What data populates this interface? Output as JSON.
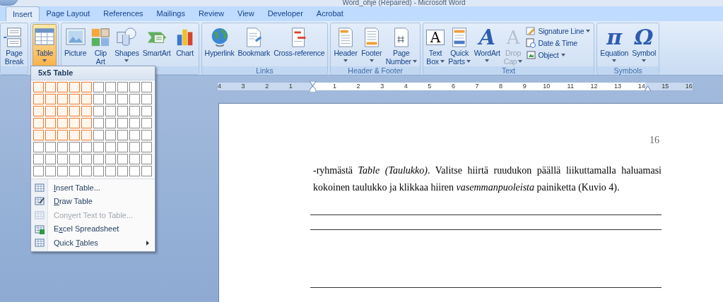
{
  "window": {
    "title": "Word_ohje (Repaired) - Microsoft Word"
  },
  "tabs": [
    {
      "label": "Insert",
      "selected": true
    },
    {
      "label": "Page Layout",
      "selected": false
    },
    {
      "label": "References",
      "selected": false
    },
    {
      "label": "Mailings",
      "selected": false
    },
    {
      "label": "Review",
      "selected": false
    },
    {
      "label": "View",
      "selected": false
    },
    {
      "label": "Developer",
      "selected": false
    },
    {
      "label": "Acrobat",
      "selected": false
    }
  ],
  "ribbon": {
    "groups": [
      {
        "buttons": [
          {
            "lines": [
              "Page",
              "Break"
            ],
            "dropdown": false,
            "selected": false,
            "disabled": false
          }
        ]
      },
      {
        "buttons": [
          {
            "lines": [
              "Table"
            ],
            "dropdown": true,
            "selected": true,
            "disabled": false
          }
        ]
      },
      {
        "buttons": [
          {
            "lines": [
              "Picture"
            ],
            "dropdown": false,
            "selected": false,
            "disabled": false
          },
          {
            "lines": [
              "Clip",
              "Art"
            ],
            "dropdown": false,
            "selected": false,
            "disabled": false
          },
          {
            "lines": [
              "Shapes"
            ],
            "dropdown": true,
            "selected": false,
            "disabled": false
          },
          {
            "lines": [
              "SmartArt"
            ],
            "dropdown": false,
            "selected": false,
            "disabled": false
          },
          {
            "lines": [
              "Chart"
            ],
            "dropdown": false,
            "selected": false,
            "disabled": false
          }
        ]
      },
      {
        "label": "Links",
        "buttons": [
          {
            "lines": [
              "Hyperlink"
            ],
            "dropdown": false,
            "selected": false,
            "disabled": false
          },
          {
            "lines": [
              "Bookmark"
            ],
            "dropdown": false,
            "selected": false,
            "disabled": false
          },
          {
            "lines": [
              "Cross-reference"
            ],
            "dropdown": false,
            "selected": false,
            "disabled": false
          }
        ]
      },
      {
        "label": "Header & Footer",
        "buttons": [
          {
            "lines": [
              "Header"
            ],
            "dropdown": true,
            "selected": false,
            "disabled": false
          },
          {
            "lines": [
              "Footer"
            ],
            "dropdown": true,
            "selected": false,
            "disabled": false
          },
          {
            "lines": [
              "Page",
              "Number"
            ],
            "dropdown": true,
            "selected": false,
            "disabled": false
          }
        ]
      },
      {
        "label": "Text",
        "buttons": [
          {
            "lines": [
              "Text",
              "Box"
            ],
            "glyph": "A",
            "dropdown": true,
            "selected": false,
            "disabled": false
          },
          {
            "lines": [
              "Quick",
              "Parts"
            ],
            "dropdown": true,
            "selected": false,
            "disabled": false
          },
          {
            "lines": [
              "WordArt"
            ],
            "glyph": "A",
            "dropdown": true,
            "selected": false,
            "disabled": false
          },
          {
            "lines": [
              "Drop",
              "Cap"
            ],
            "glyph": "A",
            "dropdown": true,
            "selected": false,
            "disabled": true
          }
        ],
        "small_buttons": [
          {
            "label": "Signature Line",
            "dropdown": true
          },
          {
            "label": "Date & Time",
            "dropdown": false
          },
          {
            "label": "Object",
            "dropdown": true
          }
        ]
      },
      {
        "label": "Symbols",
        "buttons": [
          {
            "lines": [
              "Equation"
            ],
            "glyph": "π",
            "dropdown": true,
            "selected": false,
            "disabled": false
          },
          {
            "lines": [
              "Symbol"
            ],
            "glyph": "Ω",
            "dropdown": true,
            "selected": false,
            "disabled": false
          }
        ]
      }
    ]
  },
  "table_menu": {
    "title": "5x5 Table",
    "grid": [
      [
        {
          "selected": true
        },
        {
          "selected": true
        },
        {
          "selected": true
        },
        {
          "selected": true
        },
        {
          "selected": true
        },
        {
          "selected": false
        },
        {
          "selected": false
        },
        {
          "selected": false
        },
        {
          "selected": false
        },
        {
          "selected": false
        }
      ],
      [
        {
          "selected": true
        },
        {
          "selected": true
        },
        {
          "selected": true
        },
        {
          "selected": true
        },
        {
          "selected": true
        },
        {
          "selected": false
        },
        {
          "selected": false
        },
        {
          "selected": false
        },
        {
          "selected": false
        },
        {
          "selected": false
        }
      ],
      [
        {
          "selected": true
        },
        {
          "selected": true
        },
        {
          "selected": true
        },
        {
          "selected": true
        },
        {
          "selected": true
        },
        {
          "selected": false
        },
        {
          "selected": false
        },
        {
          "selected": false
        },
        {
          "selected": false
        },
        {
          "selected": false
        }
      ],
      [
        {
          "selected": true
        },
        {
          "selected": true
        },
        {
          "selected": true
        },
        {
          "selected": true
        },
        {
          "selected": true
        },
        {
          "selected": false
        },
        {
          "selected": false
        },
        {
          "selected": false
        },
        {
          "selected": false
        },
        {
          "selected": false
        }
      ],
      [
        {
          "selected": true
        },
        {
          "selected": true
        },
        {
          "selected": true
        },
        {
          "selected": true
        },
        {
          "selected": true
        },
        {
          "selected": false
        },
        {
          "selected": false
        },
        {
          "selected": false
        },
        {
          "selected": false
        },
        {
          "selected": false
        }
      ],
      [
        {
          "selected": false
        },
        {
          "selected": false
        },
        {
          "selected": false
        },
        {
          "selected": false
        },
        {
          "selected": false
        },
        {
          "selected": false
        },
        {
          "selected": false
        },
        {
          "selected": false
        },
        {
          "selected": false
        },
        {
          "selected": false
        }
      ],
      [
        {
          "selected": false
        },
        {
          "selected": false
        },
        {
          "selected": false
        },
        {
          "selected": false
        },
        {
          "selected": false
        },
        {
          "selected": false
        },
        {
          "selected": false
        },
        {
          "selected": false
        },
        {
          "selected": false
        },
        {
          "selected": false
        }
      ],
      [
        {
          "selected": false
        },
        {
          "selected": false
        },
        {
          "selected": false
        },
        {
          "selected": false
        },
        {
          "selected": false
        },
        {
          "selected": false
        },
        {
          "selected": false
        },
        {
          "selected": false
        },
        {
          "selected": false
        },
        {
          "selected": false
        }
      ]
    ],
    "items": [
      {
        "key": "I",
        "after": "nsert Table...",
        "disabled": false,
        "submenu": false
      },
      {
        "key": "D",
        "after": "raw Table",
        "disabled": false,
        "submenu": false
      },
      {
        "before": "Con",
        "key": "v",
        "after": "ert Text to Table...",
        "disabled": true,
        "submenu": false
      },
      {
        "before": "E",
        "key": "x",
        "after": "cel Spreadsheet",
        "disabled": false,
        "submenu": false
      },
      {
        "before": "Quick ",
        "key": "T",
        "after": "ables",
        "disabled": false,
        "submenu": true
      }
    ]
  },
  "ruler": {
    "left_numbers": [
      "4",
      "3",
      "2",
      "1"
    ],
    "right_numbers": [
      "1",
      "2",
      "3",
      "4",
      "5",
      "6",
      "7",
      "8",
      "9",
      "10",
      "11",
      "12",
      "13",
      "14",
      "15",
      "16"
    ]
  },
  "document": {
    "page_number": "16",
    "paragraph": "-ryhmästä *Table (Taulukko)*. Valitse hiirtä ruudukon päällä liikuttamalla haluamasi kokoinen taulukko ja klikkaa hiiren *vasemmanpuoleista* painiketta (Kuvio 4)."
  }
}
